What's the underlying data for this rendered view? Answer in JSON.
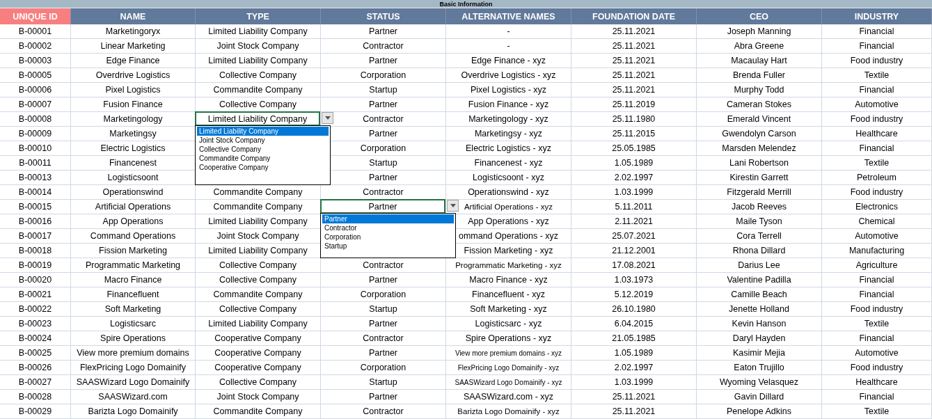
{
  "sheet_title": "Basic Information",
  "columns": [
    {
      "label": "UNIQUE ID",
      "kind": "key"
    },
    {
      "label": "NAME",
      "kind": "plain"
    },
    {
      "label": "TYPE",
      "kind": "plain"
    },
    {
      "label": "STATUS",
      "kind": "plain"
    },
    {
      "label": "ALTERNATIVE NAMES",
      "kind": "plain"
    },
    {
      "label": "FOUNDATION DATE",
      "kind": "plain"
    },
    {
      "label": "CEO",
      "kind": "plain"
    },
    {
      "label": "INDUSTRY",
      "kind": "plain"
    }
  ],
  "rows": [
    [
      "B-00001",
      "Marketingoryx",
      "Limited Liability Company",
      "Partner",
      "-",
      "25.11.2021",
      "Joseph Manning",
      "Financial"
    ],
    [
      "B-00002",
      "Linear Marketing",
      "Joint Stock Company",
      "Contractor",
      "-",
      "25.11.2021",
      "Abra Greene",
      "Financial"
    ],
    [
      "B-00003",
      "Edge Finance",
      "Limited Liability Company",
      "Partner",
      "Edge Finance - xyz",
      "25.11.2021",
      "Macaulay Hart",
      "Food industry"
    ],
    [
      "B-00005",
      "Overdrive Logistics",
      "Collective Company",
      "Corporation",
      "Overdrive Logistics - xyz",
      "25.11.2021",
      "Brenda Fuller",
      "Textile"
    ],
    [
      "B-00006",
      "Pixel Logistics",
      "Commandite Company",
      "Startup",
      "Pixel Logistics - xyz",
      "25.11.2021",
      "Murphy Todd",
      "Financial"
    ],
    [
      "B-00007",
      "Fusion Finance",
      "Collective Company",
      "Partner",
      "Fusion Finance - xyz",
      "25.11.2019",
      "Cameran Stokes",
      "Automotive"
    ],
    [
      "B-00008",
      "Marketingology",
      {
        "value": "Limited Liability Company",
        "options": [
          {
            "label": "Limited Liability Company",
            "selected": true
          },
          {
            "label": "Joint Stock Company",
            "selected": false
          },
          {
            "label": "Collective Company",
            "selected": false
          },
          {
            "label": "Commandite Company",
            "selected": false
          },
          {
            "label": "Cooperative Company",
            "selected": false
          }
        ]
      },
      "Contractor",
      "Marketingology - xyz",
      "25.11.1980",
      "Emerald Vincent",
      "Food industry"
    ],
    [
      "B-00009",
      "Marketingsy",
      null,
      "Partner",
      "Marketingsy - xyz",
      "25.11.2015",
      "Gwendolyn Carson",
      "Healthcare"
    ],
    [
      "B-00010",
      "Electric Logistics",
      null,
      "Corporation",
      "Electric Logistics - xyz",
      "25.05.1985",
      "Marsden Melendez",
      "Financial"
    ],
    [
      "B-00011",
      "Financenest",
      null,
      "Startup",
      "Financenest - xyz",
      "1.05.1989",
      "Lani Robertson",
      "Textile"
    ],
    [
      "B-00013",
      "Logisticsoont",
      null,
      "Partner",
      "Logisticsoont - xyz",
      "2.02.1997",
      "Kirestin Garrett",
      "Petroleum"
    ],
    [
      "B-00014",
      "Operationswind",
      "Commandite Company",
      "Contractor",
      "Operationswind - xyz",
      "1.03.1999",
      "Fitzgerald Merrill",
      "Food industry"
    ],
    [
      "B-00015",
      "Artificial Operations",
      "Commandite Company",
      {
        "value": "Partner",
        "options": [
          {
            "label": "Partner",
            "selected": true
          },
          {
            "label": "Contractor",
            "selected": false
          },
          {
            "label": "Corporation",
            "selected": false
          },
          {
            "label": "Startup",
            "selected": false
          }
        ]
      },
      "Artificial Operations - xyz",
      "5.11.2011",
      "Jacob Reeves",
      "Electronics"
    ],
    [
      "B-00016",
      "App Operations",
      "Limited Liability Company",
      null,
      "App Operations - xyz",
      "2.11.2021",
      "Maile Tyson",
      "Chemical"
    ],
    [
      "B-00017",
      "Command Operations",
      "Joint Stock Company",
      null,
      "ommand Operations - xyz",
      "25.07.2021",
      "Cora Terrell",
      "Automotive"
    ],
    [
      "B-00018",
      "Fission Marketing",
      "Limited Liability Company",
      null,
      "Fission Marketing - xyz",
      "21.12.2001",
      "Rhona Dillard",
      "Manufacturing"
    ],
    [
      "B-00019",
      "Programmatic Marketing",
      "Collective Company",
      "Contractor",
      "Programmatic Marketing - xyz",
      "17.08.2021",
      "Darius Lee",
      "Agriculture"
    ],
    [
      "B-00020",
      "Macro Finance",
      "Collective Company",
      "Partner",
      "Macro Finance - xyz",
      "1.03.1973",
      "Valentine Padilla",
      "Financial"
    ],
    [
      "B-00021",
      "Financefluent",
      "Commandite Company",
      "Corporation",
      "Financefluent - xyz",
      "5.12.2019",
      "Camille Beach",
      "Financial"
    ],
    [
      "B-00022",
      "Soft Marketing",
      "Collective Company",
      "Startup",
      "Soft Marketing - xyz",
      "26.10.1980",
      "Jenette Holland",
      "Food industry"
    ],
    [
      "B-00023",
      "Logisticsarc",
      "Limited Liability Company",
      "Partner",
      "Logisticsarc - xyz",
      "6.04.2015",
      "Kevin Hanson",
      "Textile"
    ],
    [
      "B-00024",
      "Spire Operations",
      "Cooperative Company",
      "Contractor",
      "Spire Operations - xyz",
      "21.05.1985",
      "Daryl Hayden",
      "Financial"
    ],
    [
      "B-00025",
      "View more premium domains",
      "Cooperative Company",
      "Partner",
      "View more premium domains - xyz",
      "1.05.1989",
      "Kasimir Mejia",
      "Automotive"
    ],
    [
      "B-00026",
      "FlexPricing Logo Domainify",
      "Cooperative Company",
      "Corporation",
      "FlexPricing Logo Domainify - xyz",
      "2.02.1997",
      "Eaton Trujillo",
      "Food industry"
    ],
    [
      "B-00027",
      "SAASWizard Logo Domainify",
      "Collective Company",
      "Startup",
      "SAASWizard Logo Domainify - xyz",
      "1.03.1999",
      "Wyoming Velasquez",
      "Healthcare"
    ],
    [
      "B-00028",
      "SAASWizard.com",
      "Joint Stock Company",
      "Partner",
      "SAASWizard.com - xyz",
      "25.11.2021",
      "Gavin Dillard",
      "Financial"
    ],
    [
      "B-00029",
      "Barizta Logo Domainify",
      "Commandite Company",
      "Contractor",
      "Barizta Logo Domainify - xyz",
      "25.11.2021",
      "Penelope Adkins",
      "Textile"
    ]
  ]
}
